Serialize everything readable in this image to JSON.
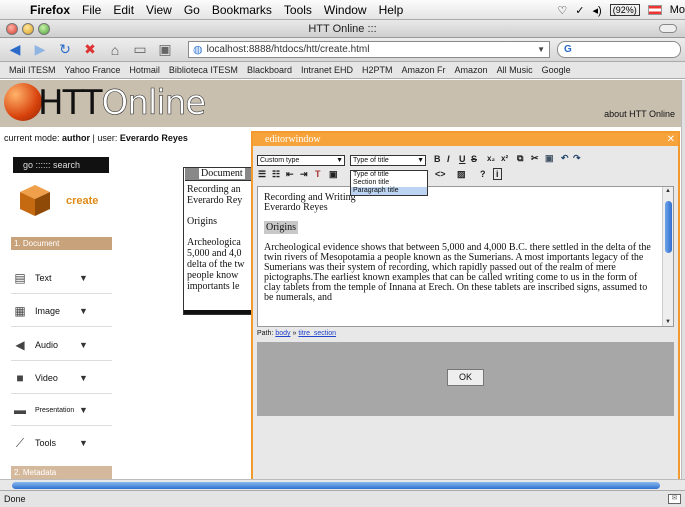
{
  "menubar": {
    "app": "Firefox",
    "items": [
      "File",
      "Edit",
      "View",
      "Go",
      "Bookmarks",
      "Tools",
      "Window",
      "Help"
    ],
    "battery": "(92%)",
    "clock": "Mo",
    "apple_icon": "apple-logo-icon"
  },
  "window": {
    "title": "HTT Online :::"
  },
  "navbar": {
    "url": "localhost:8888/htdocs/htt/create.html",
    "search_engine": "G"
  },
  "bookmarks": [
    "Mail ITESM",
    "Yahoo France",
    "Hotmail",
    "Biblioteca ITESM",
    "Blackboard",
    "Intranet EHD",
    "H2PTM",
    "Amazon Fr",
    "Amazon",
    "All Music",
    "Google"
  ],
  "header": {
    "logo_bold": "HTT",
    "logo_light": "Online",
    "about_link": "about HTT Online",
    "accent": "#e2540f"
  },
  "modeline": {
    "prefix": "current mode: ",
    "mode": "author",
    "separator": " | user: ",
    "user": "Everardo Reyes"
  },
  "sidebar": {
    "search": "go :::::: search",
    "create": "create",
    "section1": "1. Document",
    "section2": "2. Metadata",
    "items": [
      {
        "label": "Text",
        "icon": "text-document-icon"
      },
      {
        "label": "Image",
        "icon": "image-icon"
      },
      {
        "label": "Audio",
        "icon": "audio-speaker-icon"
      },
      {
        "label": "Video",
        "icon": "video-clapper-icon"
      },
      {
        "label": "Presentation",
        "icon": "presentation-icon"
      },
      {
        "label": "Tools",
        "icon": "tools-icon"
      }
    ],
    "arrow": "▼"
  },
  "document": {
    "tab": "Document",
    "lines1": [
      "Recording an",
      "Everardo Rey"
    ],
    "origins": "Origins",
    "lines2": [
      "Archeologica",
      "5,000 and 4,0",
      "delta of the tw",
      "people know",
      "importants le"
    ]
  },
  "editor": {
    "title": "editorwindow",
    "close": "✕",
    "format_select": "Custom type",
    "title_select": "Type of title",
    "title_options": [
      "Type of title",
      "Section title",
      "Paragraph title"
    ],
    "title_highlight": "Paragraph title",
    "heading": "Recording and Writing",
    "author": "Everardo Reyes",
    "section": "Origins",
    "body": "Archeological evidence shows that between 5,000 and 4,000 B.C. there settled in the delta of the twin rivers of Mesopotamia a people known as the Sumerians. A most importants legacy of the Sumerians was their system of recording, which rapidly passed out of the realm of mere pictographs.The earliest known examples that can be called writing come to us in the form of clay tablets from the temple of Innana at Erech. On these tablets are inscribed signs, assumed to be numerals, and",
    "path_label": "Path:",
    "path_body": "body",
    "path_sep": "»",
    "path_section": "titre_section",
    "ok": "OK",
    "accent": "#f5a33a"
  },
  "status": {
    "text": "Done"
  }
}
